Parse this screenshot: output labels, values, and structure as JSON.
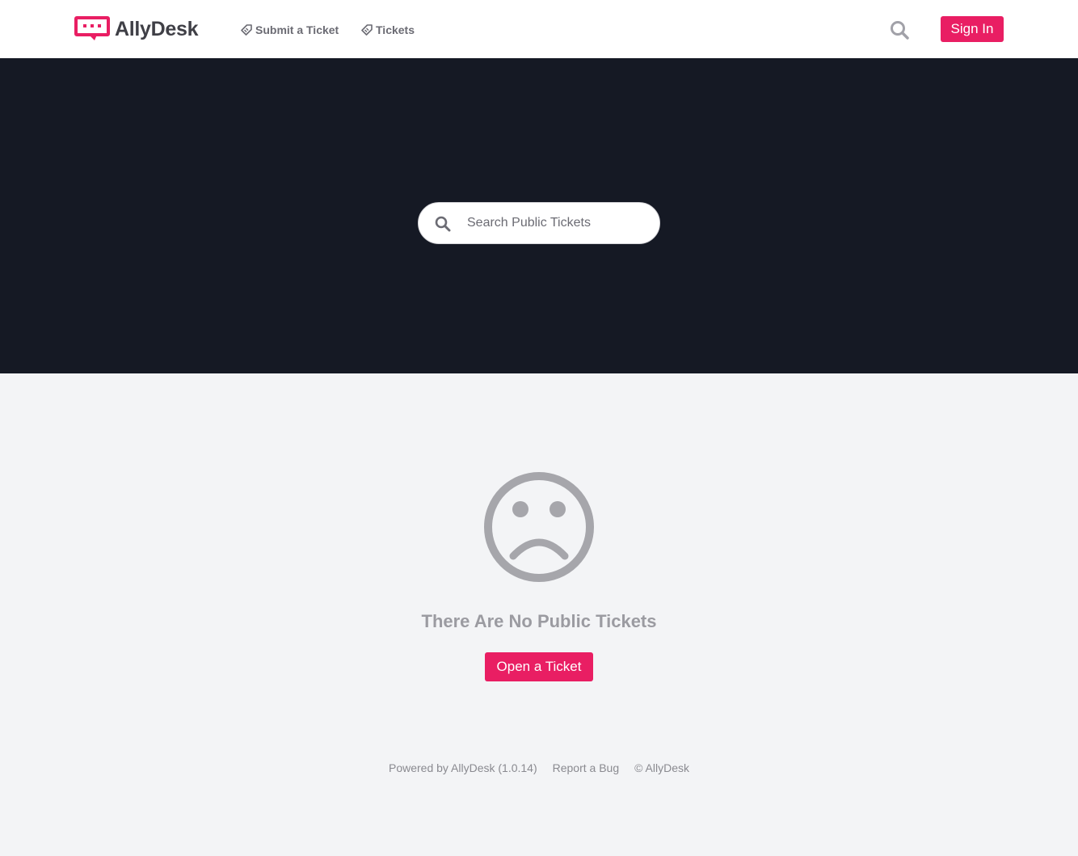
{
  "brand": {
    "name": "AllyDesk",
    "accent_color": "#e91e63",
    "logo_icon": "chat-bubble-dots-icon"
  },
  "nav": {
    "items": [
      {
        "label": "Submit a Ticket",
        "icon": "ticket-tag-icon"
      },
      {
        "label": "Tickets",
        "icon": "ticket-tag-icon"
      }
    ],
    "search_icon": "search-icon",
    "sign_in_label": "Sign In"
  },
  "hero": {
    "background_color": "#151924",
    "search_placeholder": "Search Public Tickets",
    "search_value": ""
  },
  "empty_state": {
    "icon": "sad-face-icon",
    "message": "There Are No Public Tickets",
    "cta_label": "Open a Ticket"
  },
  "footer": {
    "powered_by": "Powered by AllyDesk (1.0.14)",
    "report_bug": "Report a Bug",
    "copyright": "© AllyDesk"
  }
}
